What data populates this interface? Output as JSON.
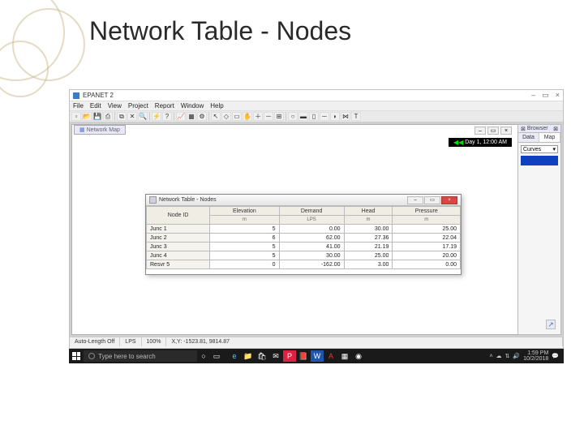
{
  "slide": {
    "title": "Network Table - Nodes",
    "number": ""
  },
  "app": {
    "title": "EPANET 2",
    "menu": [
      "File",
      "Edit",
      "View",
      "Project",
      "Report",
      "Window",
      "Help"
    ],
    "subwindow_title": "Network Map",
    "time_badge": "Day 1, 12:00 AM",
    "status": {
      "autolen": "Auto-Length Off",
      "units": "LPS",
      "zoom": "100%",
      "xy": "X,Y: -1523.81, 9814.87"
    },
    "win_buttons": {
      "min": "–",
      "max": "▭",
      "close": "×"
    }
  },
  "browser": {
    "title": "Browser",
    "tabs": [
      "Data",
      "Map"
    ],
    "combo": "Curves"
  },
  "dialog": {
    "title": "Network Table - Nodes",
    "columns": [
      "Node ID",
      "Elevation",
      "Demand",
      "Head",
      "Pressure"
    ],
    "units": [
      "",
      "m",
      "LPS",
      "m",
      "m"
    ],
    "rows": [
      {
        "id": "Junc 1",
        "elev": "5",
        "demand": "0.00",
        "head": "30.00",
        "pres": "25.00"
      },
      {
        "id": "Junc 2",
        "elev": "6",
        "demand": "62.00",
        "head": "27.36",
        "pres": "22.04"
      },
      {
        "id": "Junc 3",
        "elev": "5",
        "demand": "41.00",
        "head": "21.19",
        "pres": "17.19"
      },
      {
        "id": "Junc 4",
        "elev": "5",
        "demand": "30.00",
        "head": "25.00",
        "pres": "20.00"
      },
      {
        "id": "Resvr 5",
        "elev": "0",
        "demand": "-162.00",
        "head": "3.00",
        "pres": "0.00"
      }
    ]
  },
  "taskbar": {
    "search_placeholder": "Type here to search",
    "time": "1:59 PM",
    "date": "10/2/2018"
  },
  "icons": {
    "edge": "e",
    "folder": "📁",
    "store": "🛍",
    "mail": "✉",
    "pp": "P",
    "pdf": "📕",
    "word": "W",
    "acad": "A",
    "chrome": "◉",
    "app": "◆",
    "misc": "▦",
    "cort": "○",
    "task": "▭"
  }
}
